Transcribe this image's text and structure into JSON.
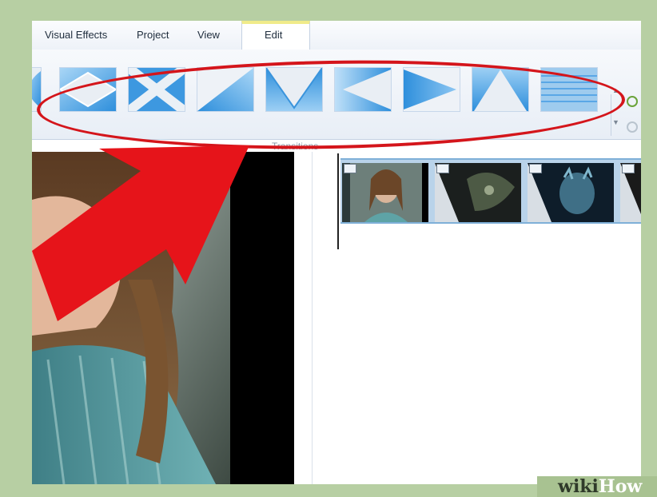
{
  "ribbon": {
    "tabs": [
      "Visual Effects",
      "Project",
      "View",
      "Edit"
    ],
    "active_tab": "Edit",
    "group_label": "Transitions",
    "transitions": [
      "wipe-left",
      "diamond",
      "cross",
      "diagonal",
      "v-shape",
      "arrow-left",
      "arrow-right",
      "triangle-up",
      "lines"
    ]
  },
  "storyboard": {
    "clips": [
      "girl-portrait",
      "dark-creature",
      "blue-creature",
      "dark-partial"
    ]
  },
  "watermark": {
    "part1": "wiki",
    "part2": "How"
  },
  "colors": {
    "highlight_red": "#d4151b",
    "transition_blue": "#4aa3e8",
    "clip_strip": "#b9d3ea"
  }
}
